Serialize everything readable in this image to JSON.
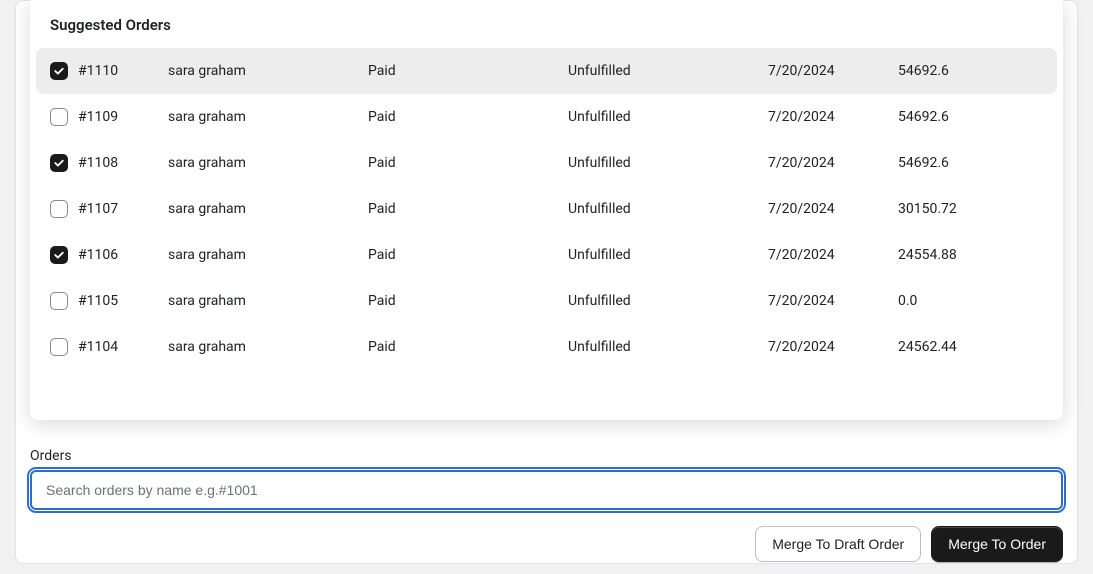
{
  "dropdown": {
    "header": "Suggested Orders",
    "rows": [
      {
        "checked": true,
        "highlighted": true,
        "id": "#1110",
        "customer": "sara graham",
        "payment": "Paid",
        "fulfillment": "Unfulfilled",
        "date": "7/20/2024",
        "amount": "54692.6"
      },
      {
        "checked": false,
        "highlighted": false,
        "id": "#1109",
        "customer": "sara graham",
        "payment": "Paid",
        "fulfillment": "Unfulfilled",
        "date": "7/20/2024",
        "amount": "54692.6"
      },
      {
        "checked": true,
        "highlighted": false,
        "id": "#1108",
        "customer": "sara graham",
        "payment": "Paid",
        "fulfillment": "Unfulfilled",
        "date": "7/20/2024",
        "amount": "54692.6"
      },
      {
        "checked": false,
        "highlighted": false,
        "id": "#1107",
        "customer": "sara graham",
        "payment": "Paid",
        "fulfillment": "Unfulfilled",
        "date": "7/20/2024",
        "amount": "30150.72"
      },
      {
        "checked": true,
        "highlighted": false,
        "id": "#1106",
        "customer": "sara graham",
        "payment": "Paid",
        "fulfillment": "Unfulfilled",
        "date": "7/20/2024",
        "amount": "24554.88"
      },
      {
        "checked": false,
        "highlighted": false,
        "id": "#1105",
        "customer": "sara graham",
        "payment": "Paid",
        "fulfillment": "Unfulfilled",
        "date": "7/20/2024",
        "amount": "0.0"
      },
      {
        "checked": false,
        "highlighted": false,
        "id": "#1104",
        "customer": "sara graham",
        "payment": "Paid",
        "fulfillment": "Unfulfilled",
        "date": "7/20/2024",
        "amount": "24562.44"
      }
    ]
  },
  "orders": {
    "label": "Orders",
    "search_placeholder": "Search orders by name e.g.#1001"
  },
  "buttons": {
    "merge_draft": "Merge To Draft Order",
    "merge_order": "Merge To Order"
  }
}
